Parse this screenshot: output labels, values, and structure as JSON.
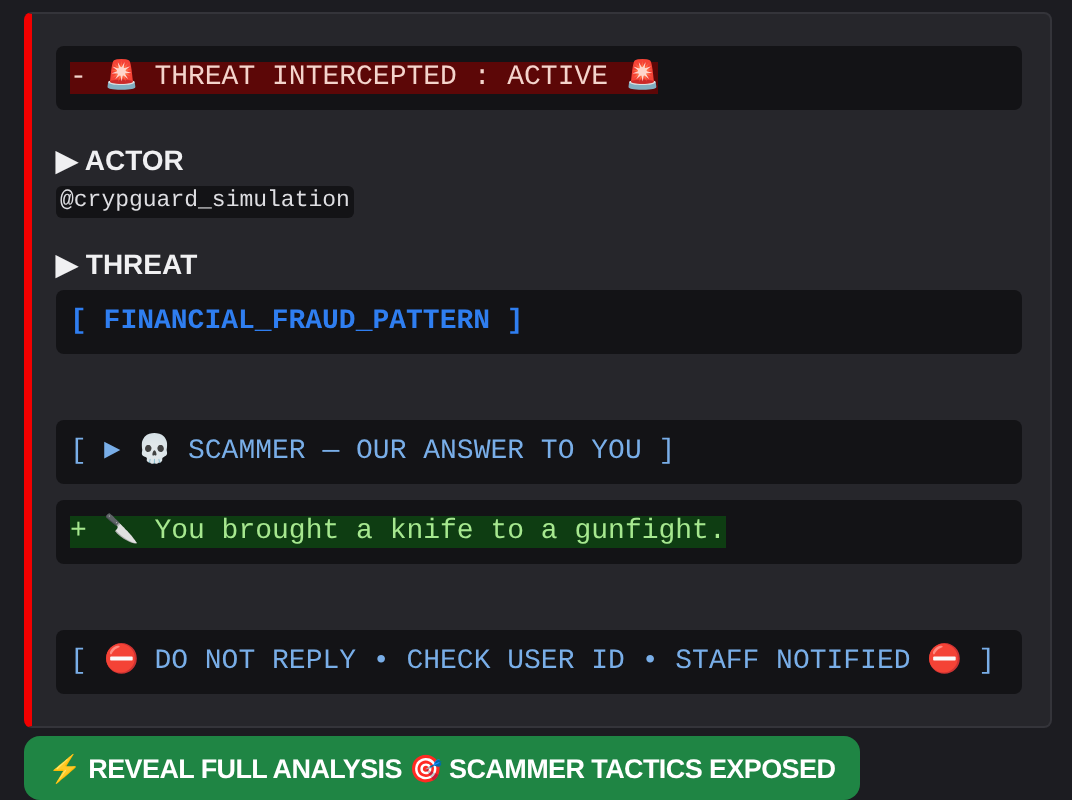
{
  "embed": {
    "sections": [
      {
        "kind": "diff_removed",
        "text": "- 🚨 THREAT INTERCEPTED : ACTIVE 🚨"
      },
      {
        "kind": "field_inline",
        "name": "▶ ACTOR",
        "value": "@crypguard_simulation"
      },
      {
        "kind": "field_block",
        "name": "▶ THREAT",
        "value": "[ FINANCIAL_FRAUD_PATTERN ]"
      },
      {
        "kind": "gap"
      },
      {
        "kind": "code_light",
        "text": "[ ► 💀 SCAMMER — OUR ANSWER TO YOU ]"
      },
      {
        "kind": "diff_added",
        "text": "+ 🔪 You brought a knife to a gunfight."
      },
      {
        "kind": "gap"
      },
      {
        "kind": "code_light",
        "text": "[ ⛔ DO NOT REPLY • CHECK USER ID • STAFF NOTIFIED ⛔ ]"
      }
    ]
  },
  "button": {
    "label": "⚡ REVEAL FULL ANALYSIS 🎯 SCAMMER TACTICS EXPOSED"
  }
}
